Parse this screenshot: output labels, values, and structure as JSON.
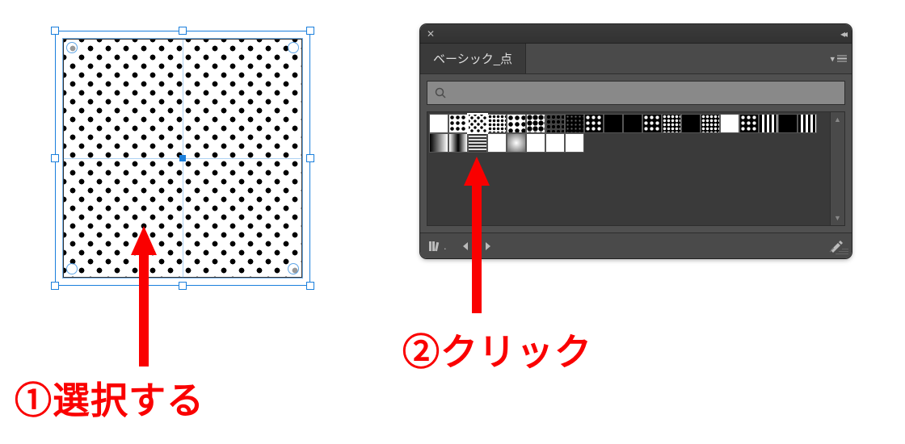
{
  "canvas": {
    "selected_object_name": "polka-dot-rectangle"
  },
  "panel": {
    "tab_label": "ベーシック_点",
    "search_placeholder": ""
  },
  "swatches": {
    "selected_index": 2,
    "items": [
      "white",
      "dot-sparse",
      "dot-staggered-small",
      "dot-dense",
      "dot-large",
      "dot-heavy",
      "dot-dark",
      "dot-on-black-small",
      "dot-on-black",
      "black",
      "black-2",
      "inverse-dot-large",
      "inverse-dot-small",
      "black-3",
      "inverse-dense",
      "white-2",
      "inverse-heavy",
      "stripe-vertical",
      "black-4",
      "stripe-vertical-2",
      "gradient-lr",
      "gradient-center",
      "horizontal-lines",
      "gradient-white",
      "gradient-radial",
      "blank-1",
      "blank-2",
      "blank-3"
    ]
  },
  "annotations": {
    "label1": "①選択する",
    "label2": "②クリック"
  },
  "icons": {
    "close": "close-icon",
    "collapse": "collapse-icon",
    "panel_menu": "panel-menu-icon",
    "search": "search-icon",
    "library": "library-icon",
    "prev": "prev-swatch-icon",
    "next": "next-swatch-icon",
    "edit": "edit-swatch-icon",
    "scroll_up": "scroll-up-icon",
    "scroll_down": "scroll-down-icon"
  }
}
